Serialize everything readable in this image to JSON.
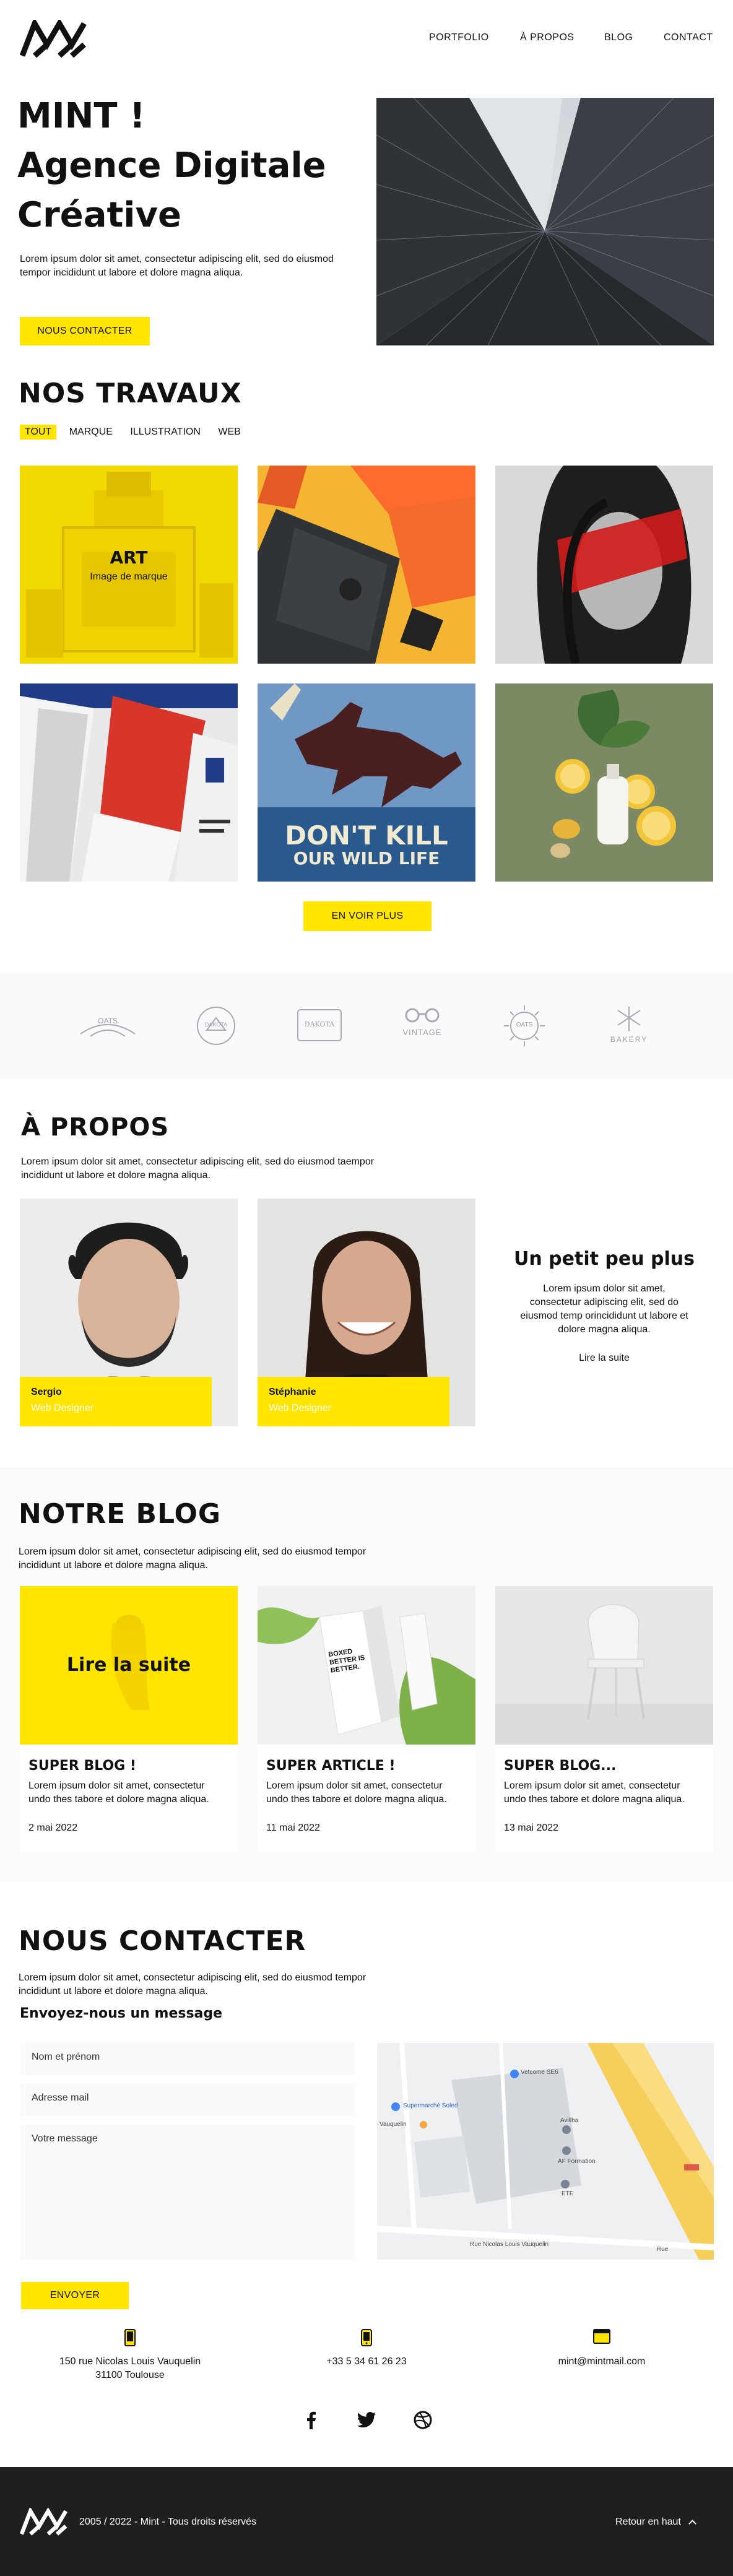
{
  "nav": {
    "items": [
      "PORTFOLIO",
      "À PROPOS",
      "BLOG",
      "CONTACT"
    ]
  },
  "hero": {
    "title_line1": "MINT !",
    "title_line2": "Agence Digitale",
    "title_line3": "Créative",
    "text": "Lorem ipsum dolor sit amet, consectetur adipiscing elit, sed do eiusmod tempor incididunt ut labore et dolore magna aliqua.",
    "button": "NOUS CONTACTER"
  },
  "works": {
    "title": "NOS TRAVAUX",
    "filters": [
      "TOUT",
      "MARQUE",
      "ILLUSTRATION",
      "WEB"
    ],
    "active_filter": "TOUT",
    "overlay_title": "ART",
    "overlay_sub": "Image de marque",
    "poster_line1": "DON'T KILL",
    "poster_line2": "OUR WILD LIFE",
    "more_button": "EN VOIR PLUS"
  },
  "logos": [
    "OATS",
    "DAKOTA",
    "DAKOTA",
    "VINTAGE",
    "OATS",
    "BAKERY"
  ],
  "about": {
    "title": "À PROPOS",
    "text": "Lorem ipsum dolor sit amet, consectetur adipiscing elit, sed do eiusmod taempor incididunt ut labore et dolore magna aliqua.",
    "members": [
      {
        "name": "Sergio",
        "role": "Web Designer"
      },
      {
        "name": "Stéphanie",
        "role": "Web Designer"
      }
    ],
    "extra_title": "Un petit peu plus",
    "extra_text": "Lorem ipsum dolor sit amet, consectetur adipiscing elit, sed do eiusmod temp orincididunt ut labore et dolore magna aliqua.",
    "extra_link": "Lire la suite"
  },
  "blog": {
    "title": "NOTRE BLOG",
    "text": "Lorem ipsum dolor sit amet, consectetur adipiscing elit, sed do eiusmod tempor incididunt ut labore et dolore magna aliqua.",
    "overlay": "Lire la suite",
    "posts": [
      {
        "title": "SUPER BLOG !",
        "text": "Lorem ipsum dolor sit amet, consectetur undo thes tabore et dolore magna aliqua.",
        "date": "2 mai 2022"
      },
      {
        "title": "SUPER ARTICLE !",
        "text": "Lorem ipsum dolor sit amet, consectetur undo thes tabore et dolore magna aliqua.",
        "date": "11 mai 2022"
      },
      {
        "title": "SUPER BLOG...",
        "text": "Lorem ipsum dolor sit amet, consectetur undo thes tabore et dolore magna aliqua.",
        "date": "13 mai 2022"
      }
    ],
    "carton_text": "BOXED BETTER IS BETTER."
  },
  "contact": {
    "title": "NOUS CONTACTER",
    "text": "Lorem ipsum dolor sit amet, consectetur adipiscing elit, sed do eiusmod tempor incididunt ut labore et dolore magna aliqua.",
    "subtitle": "Envoyez-nous un message",
    "name_placeholder": "Nom et prénom",
    "email_placeholder": "Adresse mail",
    "message_placeholder": "Votre message",
    "send_button": "ENVOYER",
    "address_line1": "150 rue Nicolas Louis Vauquelin",
    "address_line2": "31100 Toulouse",
    "phone": "+33 5 34 61 26 23",
    "email": "mint@mintmail.com",
    "map_labels": [
      "Vetcome SE6",
      "Supermarché Soled",
      "Vauquelin",
      "Avillba",
      "AF Formation",
      "ETE",
      "Rue Nicolas Louis Vauquelin",
      "Rue"
    ]
  },
  "footer": {
    "copyright": "2005 / 2022 - Mint - Tous droits réservés",
    "back_top": "Retour en haut"
  },
  "colors": {
    "accent": "#ffe500",
    "dark": "#1f1f1f"
  }
}
